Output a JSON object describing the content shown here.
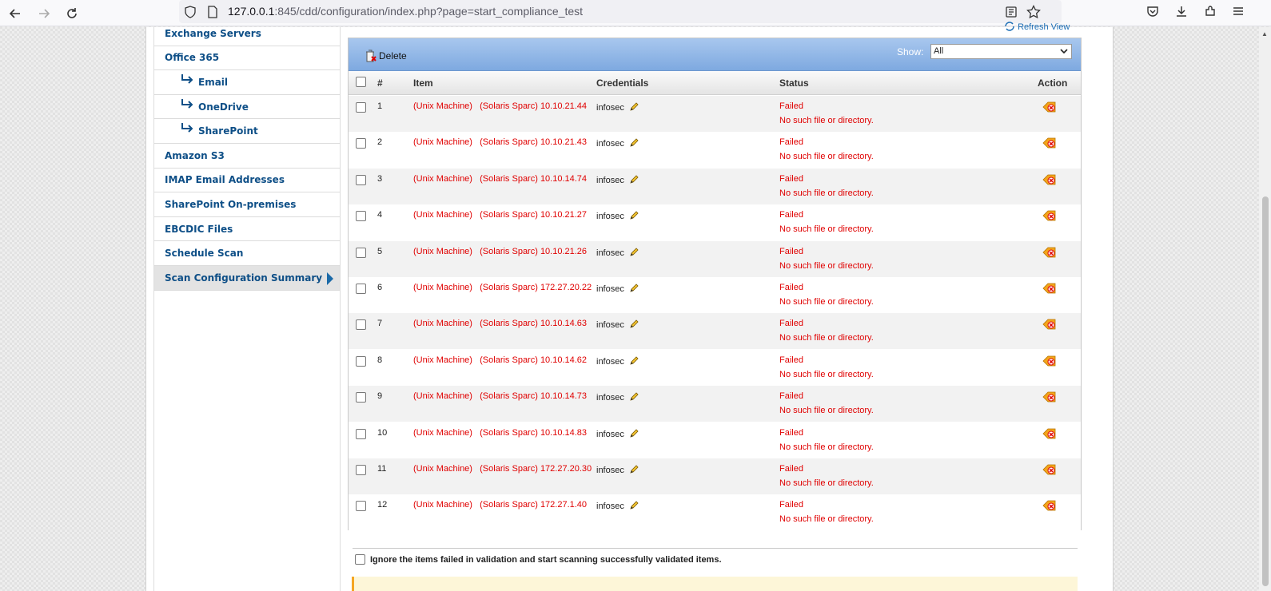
{
  "browser": {
    "url_host": "127.0.0.1",
    "url_rest": ":845/cdd/configuration/index.php?page=start_compliance_test"
  },
  "sidebar": {
    "items": [
      {
        "label": "Exchange Servers",
        "sub": false,
        "active": false
      },
      {
        "label": "Office 365",
        "sub": false,
        "active": false
      },
      {
        "label": "Email",
        "sub": true,
        "active": false
      },
      {
        "label": "OneDrive",
        "sub": true,
        "active": false
      },
      {
        "label": "SharePoint",
        "sub": true,
        "active": false
      },
      {
        "label": "Amazon S3",
        "sub": false,
        "active": false
      },
      {
        "label": "IMAP Email Addresses",
        "sub": false,
        "active": false
      },
      {
        "label": "SharePoint On-premises",
        "sub": false,
        "active": false
      },
      {
        "label": "EBCDIC Files",
        "sub": false,
        "active": false
      },
      {
        "label": "Schedule Scan",
        "sub": false,
        "active": false
      },
      {
        "label": "Scan Configuration Summary",
        "sub": false,
        "active": true
      }
    ]
  },
  "content": {
    "refresh_label": "Refresh View",
    "delete_label": "Delete",
    "show_label": "Show:",
    "show_value": "All",
    "columns": {
      "num": "#",
      "item": "Item",
      "credentials": "Credentials",
      "status": "Status",
      "action": "Action"
    },
    "rows": [
      {
        "num": "1",
        "type": "(Unix Machine)",
        "item": "(Solaris Sparc) 10.10.21.44",
        "cred": "infosec",
        "status": "Failed",
        "detail": "No such file or directory."
      },
      {
        "num": "2",
        "type": "(Unix Machine)",
        "item": "(Solaris Sparc) 10.10.21.43",
        "cred": "infosec",
        "status": "Failed",
        "detail": "No such file or directory."
      },
      {
        "num": "3",
        "type": "(Unix Machine)",
        "item": "(Solaris Sparc) 10.10.14.74",
        "cred": "infosec",
        "status": "Failed",
        "detail": "No such file or directory."
      },
      {
        "num": "4",
        "type": "(Unix Machine)",
        "item": "(Solaris Sparc) 10.10.21.27",
        "cred": "infosec",
        "status": "Failed",
        "detail": "No such file or directory."
      },
      {
        "num": "5",
        "type": "(Unix Machine)",
        "item": "(Solaris Sparc) 10.10.21.26",
        "cred": "infosec",
        "status": "Failed",
        "detail": "No such file or directory."
      },
      {
        "num": "6",
        "type": "(Unix Machine)",
        "item": "(Solaris Sparc) 172.27.20.22",
        "cred": "infosec",
        "status": "Failed",
        "detail": "No such file or directory."
      },
      {
        "num": "7",
        "type": "(Unix Machine)",
        "item": "(Solaris Sparc) 10.10.14.63",
        "cred": "infosec",
        "status": "Failed",
        "detail": "No such file or directory."
      },
      {
        "num": "8",
        "type": "(Unix Machine)",
        "item": "(Solaris Sparc) 10.10.14.62",
        "cred": "infosec",
        "status": "Failed",
        "detail": "No such file or directory."
      },
      {
        "num": "9",
        "type": "(Unix Machine)",
        "item": "(Solaris Sparc) 10.10.14.73",
        "cred": "infosec",
        "status": "Failed",
        "detail": "No such file or directory."
      },
      {
        "num": "10",
        "type": "(Unix Machine)",
        "item": "(Solaris Sparc) 10.10.14.83",
        "cred": "infosec",
        "status": "Failed",
        "detail": "No such file or directory."
      },
      {
        "num": "11",
        "type": "(Unix Machine)",
        "item": "(Solaris Sparc) 172.27.20.30",
        "cred": "infosec",
        "status": "Failed",
        "detail": "No such file or directory."
      },
      {
        "num": "12",
        "type": "(Unix Machine)",
        "item": "(Solaris Sparc) 172.27.1.40",
        "cred": "infosec",
        "status": "Failed",
        "detail": "No such file or directory."
      }
    ],
    "ignore_label": "Ignore the items failed in validation and start scanning successfully validated items."
  },
  "colors": {
    "failed_red": "#e00000",
    "link_blue": "#0e4f87",
    "toolbar_blue": "#7ea9e0"
  }
}
